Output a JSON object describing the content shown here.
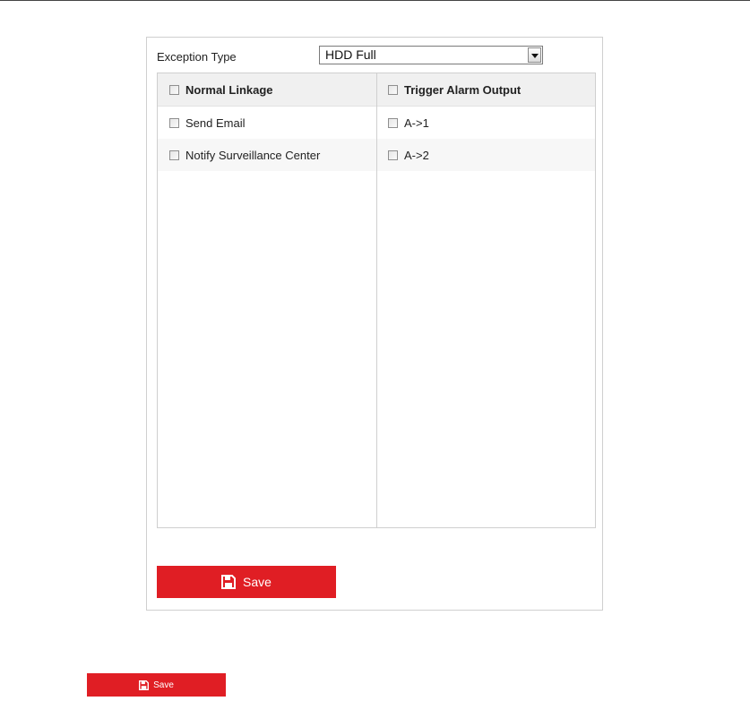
{
  "exception": {
    "label": "Exception Type",
    "selected": "HDD Full"
  },
  "normal_linkage": {
    "header": "Normal Linkage",
    "items": [
      {
        "label": "Send Email"
      },
      {
        "label": "Notify Surveillance Center"
      }
    ]
  },
  "alarm_output": {
    "header": "Trigger Alarm Output",
    "items": [
      {
        "label": "A->1"
      },
      {
        "label": "A->2"
      }
    ]
  },
  "save": {
    "label": "Save",
    "color": "#e01e24",
    "icon": "floppy-disk-icon"
  },
  "save_small": {
    "label": "Save"
  }
}
